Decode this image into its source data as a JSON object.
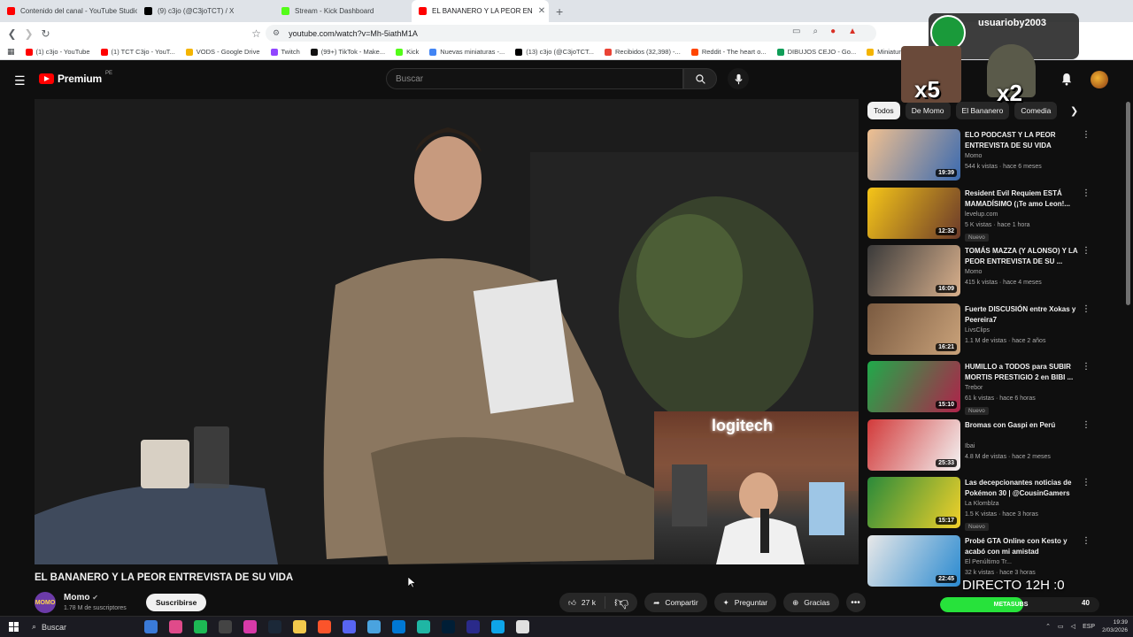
{
  "browser": {
    "tabs": [
      {
        "label": "Contenido del canal - YouTube Studio",
        "color": "#ff0000"
      },
      {
        "label": "(9) c3jo (@C3joTCT) / X",
        "color": "#000000"
      },
      {
        "label": "Stream - Kick Dashboard",
        "color": "#53fc18"
      },
      {
        "label": "EL BANANERO Y LA PEOR EN",
        "color": "#ff0000",
        "active": true
      }
    ],
    "url": "youtube.com/watch?v=Mh-5iathM1A",
    "bookmarks": [
      {
        "label": "(1) c3jo - YouTube",
        "color": "#ff0000"
      },
      {
        "label": "(1) TCT C3jo - YouT...",
        "color": "#ff0000"
      },
      {
        "label": "VODS - Google Drive",
        "color": "#f4b400"
      },
      {
        "label": "Twitch",
        "color": "#9146ff"
      },
      {
        "label": "(99+) TikTok - Make...",
        "color": "#111111"
      },
      {
        "label": "Kick",
        "color": "#53fc18"
      },
      {
        "label": "Nuevas miniaturas -...",
        "color": "#4285f4"
      },
      {
        "label": "(13) c3jo (@C3joTCT...",
        "color": "#000000"
      },
      {
        "label": "Recibidos (32,398) -...",
        "color": "#ea4335"
      },
      {
        "label": "Reddit - The heart o...",
        "color": "#ff4500"
      },
      {
        "label": "DIBUJOS CEJO - Go...",
        "color": "#0f9d58"
      },
      {
        "label": "Miniaturas",
        "color": "#f4b400"
      }
    ]
  },
  "youtube": {
    "brand": "Premium",
    "region": "PE",
    "search_placeholder": "Buscar",
    "video": {
      "title": "EL BANANERO Y LA PEOR ENTREVISTA DE SU VIDA",
      "channel": "Momo",
      "channel_avatar_text": "MOMO",
      "subscribers": "1.78 M de suscriptores",
      "subscribe_label": "Suscribirse",
      "likes": "27 k",
      "share_label": "Compartir",
      "ask_label": "Preguntar",
      "thanks_label": "Gracias"
    },
    "chips": [
      "Todos",
      "De Momo",
      "El Bananero",
      "Comedia"
    ],
    "recommendations": [
      {
        "title": "ELO PODCAST Y LA PEOR ENTREVISTA DE SU VIDA",
        "channel": "Momo",
        "meta": "544 k vistas · hace 6 meses",
        "duration": "19:39",
        "badge": "",
        "c1": "#f0c090",
        "c2": "#3a6ab0"
      },
      {
        "title": "Resident Evil Requiem ESTÁ MAMADÍSIMO (¡Te amo Leon!...",
        "channel": "levelup.com",
        "meta": "5 K vistas · hace 1 hora",
        "duration": "12:32",
        "badge": "Nuevo",
        "c1": "#f5c518",
        "c2": "#6b3a2a"
      },
      {
        "title": "TOMÁS MAZZA (Y ALONSO) Y LA PEOR ENTREVISTA DE SU ...",
        "channel": "Momo",
        "meta": "415 k vistas · hace 4 meses",
        "duration": "16:09",
        "badge": "",
        "c1": "#3a3a3a",
        "c2": "#d9b08c"
      },
      {
        "title": "Fuerte DISCUSIÓN entre Xokas y Peereira7",
        "channel": "LivsClips",
        "meta": "1.1 M de vistas · hace 2 años",
        "duration": "16:21",
        "badge": "",
        "c1": "#7a5a40",
        "c2": "#c9a27a"
      },
      {
        "title": "HUMILLO a TODOS para SUBIR MORTIS PRESTIGIO 2 en BIBI ...",
        "channel": "Trebor",
        "meta": "61 k vistas · hace 6 horas",
        "duration": "15:10",
        "badge": "Nuevo",
        "c1": "#1faa4a",
        "c2": "#b0224a"
      },
      {
        "title": "Bromas con Gaspi en Perú",
        "channel": "Ibai",
        "meta": "4.8 M de vistas · hace 2 meses",
        "duration": "25:33",
        "badge": "",
        "c1": "#d23a3a",
        "c2": "#f3f3f3"
      },
      {
        "title": "Las decepcionantes noticias de Pokémon 30 | @CousinGamers",
        "channel": "La Klomblza",
        "meta": "1.5 K vistas · hace 3 horas",
        "duration": "15:17",
        "badge": "Nuevo",
        "c1": "#2a8a3a",
        "c2": "#f2d12a"
      },
      {
        "title": "Probé GTA Online con Kesto y acabó con mi amistad",
        "channel": "El Penúltimo Tr...",
        "meta": "32 k vistas · hace 3 horas",
        "duration": "22:45",
        "badge": "",
        "c1": "#e8e8e8",
        "c2": "#2a8ad0"
      }
    ]
  },
  "stream_overlay": {
    "username": "usuarioby2003",
    "multiplier_a": "x5",
    "multiplier_b": "x2",
    "directo": "DIRECTO 12H :0",
    "goal_label": "METASUBS",
    "goal_count": "40",
    "goal_progress": 0.52,
    "cam_brand": "logitech"
  },
  "taskbar": {
    "search_label": "Buscar",
    "lang": "ESP",
    "time": "19:39",
    "date": "2/03/2026",
    "apps": [
      "#3a7ad8",
      "#e04a8a",
      "#1db954",
      "#444444",
      "#d83aa8",
      "#1b2838",
      "#f2c94c",
      "#fb542b",
      "#5865f2",
      "#4aa3df",
      "#0078d4",
      "#1fb6a4",
      "#001e36",
      "#2a2a8a",
      "#0ea5e9",
      "#e0e0e0"
    ]
  }
}
